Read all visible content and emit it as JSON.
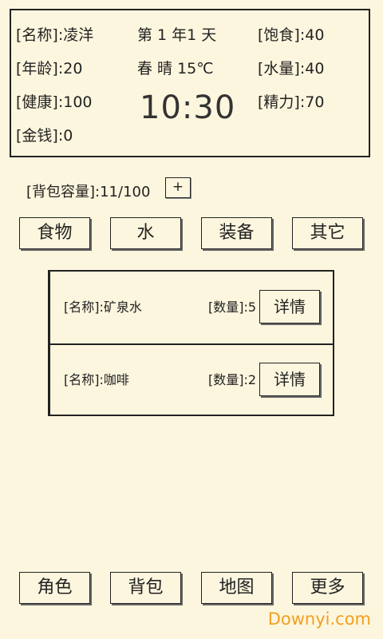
{
  "status": {
    "name": "[名称]:凌洋",
    "date": "第 1 年1 天",
    "satiety": "[饱食]:40",
    "age": "[年龄]:20",
    "weather": "春  晴  15℃",
    "water": "[水量]:40",
    "health": "[健康]:100",
    "time": "10:30",
    "energy": "[精力]:70",
    "money": "[金钱]:0"
  },
  "bag": {
    "capacity": "[背包容量]:11/100",
    "add_label": "+"
  },
  "categories": [
    "食物",
    "水",
    "装备",
    "其它"
  ],
  "items": [
    {
      "name": "[名称]:矿泉水",
      "qty": "[数量]:5",
      "detail": "详情"
    },
    {
      "name": "[名称]:咖啡",
      "qty": "[数量]:2",
      "detail": "详情"
    }
  ],
  "nav": [
    "角色",
    "背包",
    "地图",
    "更多"
  ],
  "watermark": "Downyi.com"
}
